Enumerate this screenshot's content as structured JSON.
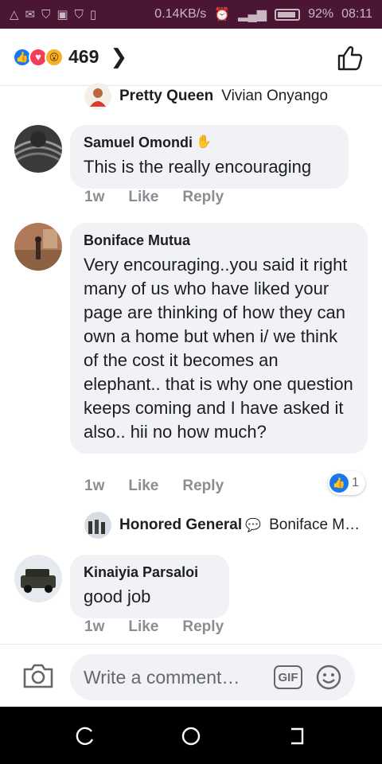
{
  "status_bar": {
    "speed": "0.14KB/s",
    "battery": "92%",
    "time": "08:11"
  },
  "reactions": {
    "count": "469",
    "types": [
      "like",
      "love",
      "wow"
    ]
  },
  "comments": [
    {
      "type": "reply_preview",
      "name": "Pretty Queen",
      "text": "Vivian Onyango"
    },
    {
      "type": "comment",
      "name": "Samuel Omondi",
      "badge_icon": "waving-hand-icon",
      "text": "This is the really encouraging",
      "time": "1w",
      "like_label": "Like",
      "reply_label": "Reply"
    },
    {
      "type": "comment",
      "name": "Boniface Mutua",
      "text": "Very encouraging..you said it right many of us who have liked your page are thinking of how they can own a home but when i/ we think of the cost it becomes an elephant.. that is why one question keeps coming and I have asked it also.. hii no how much?",
      "time": "1w",
      "like_label": "Like",
      "reply_label": "Reply",
      "reactions_count": "1"
    },
    {
      "type": "reply_preview",
      "name": "Honored General",
      "text": "Boniface M…"
    },
    {
      "type": "comment",
      "name": "Kinaiyia Parsaloi",
      "text": "good job",
      "time": "1w",
      "like_label": "Like",
      "reply_label": "Reply"
    }
  ],
  "composer": {
    "placeholder": "Write a comment…",
    "gif_label": "GIF"
  },
  "colors": {
    "status_bg": "#4a1634",
    "like_blue": "#1877f2",
    "bubble_bg": "#f0f2f5",
    "meta_grey": "#8a8d91"
  }
}
